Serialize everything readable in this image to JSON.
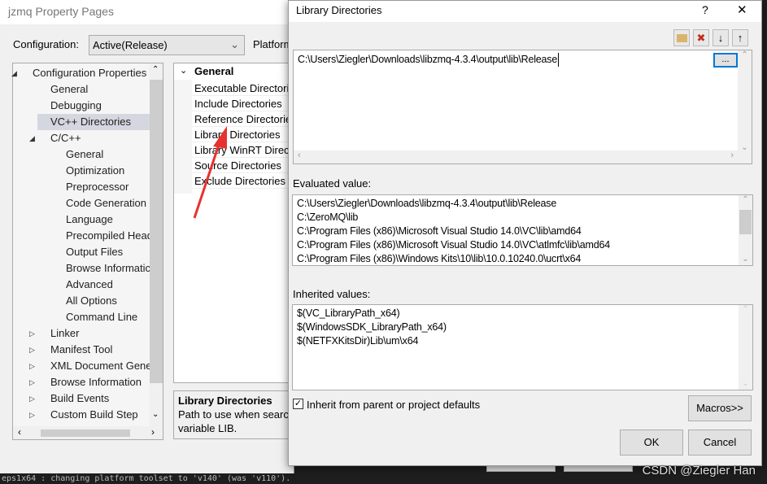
{
  "main": {
    "title": "jzmq Property Pages",
    "configuration_label": "Configuration:",
    "configuration_value": "Active(Release)",
    "platform_label": "Platform",
    "tree": [
      {
        "label": "Configuration Properties",
        "level": 0,
        "expanded": true
      },
      {
        "label": "General",
        "level": 1
      },
      {
        "label": "Debugging",
        "level": 1
      },
      {
        "label": "VC++ Directories",
        "level": 1,
        "selected": true
      },
      {
        "label": "C/C++",
        "level": 1,
        "expanded": true
      },
      {
        "label": "General",
        "level": 2
      },
      {
        "label": "Optimization",
        "level": 2
      },
      {
        "label": "Preprocessor",
        "level": 2
      },
      {
        "label": "Code Generation",
        "level": 2
      },
      {
        "label": "Language",
        "level": 2
      },
      {
        "label": "Precompiled Head",
        "level": 2
      },
      {
        "label": "Output Files",
        "level": 2
      },
      {
        "label": "Browse Informatic",
        "level": 2
      },
      {
        "label": "Advanced",
        "level": 2
      },
      {
        "label": "All Options",
        "level": 2
      },
      {
        "label": "Command Line",
        "level": 2
      },
      {
        "label": "Linker",
        "level": 1,
        "collapsed": true
      },
      {
        "label": "Manifest Tool",
        "level": 1,
        "collapsed": true
      },
      {
        "label": "XML Document Gene",
        "level": 1,
        "collapsed": true
      },
      {
        "label": "Browse Information",
        "level": 1,
        "collapsed": true
      },
      {
        "label": "Build Events",
        "level": 1,
        "collapsed": true
      },
      {
        "label": "Custom Build Step",
        "level": 1,
        "collapsed": true
      }
    ],
    "grid": {
      "section": "General",
      "rows": [
        "Executable Directori",
        "Include Directories",
        "Reference Directorie",
        "Library Directories",
        "Library WinRT Direc",
        "Source Directories",
        "Exclude Directories"
      ]
    },
    "description": {
      "title": "Library Directories",
      "line1": "Path to use when searc",
      "line2": "variable LIB."
    }
  },
  "dialog": {
    "title": "Library Directories",
    "help": "?",
    "close": "✕",
    "toolbar": {
      "new_line": "new-folder-icon",
      "delete": "✖",
      "down": "🡓",
      "up": "🡑"
    },
    "edit_value": "C:\\Users\\Ziegler\\Downloads\\libzmq-4.3.4\\output\\lib\\Release",
    "browse_label": "...",
    "evaluated_label": "Evaluated value:",
    "evaluated": [
      "C:\\Users\\Ziegler\\Downloads\\libzmq-4.3.4\\output\\lib\\Release",
      "C:\\ZeroMQ\\lib",
      "C:\\Program Files (x86)\\Microsoft Visual Studio 14.0\\VC\\lib\\amd64",
      "C:\\Program Files (x86)\\Microsoft Visual Studio 14.0\\VC\\atlmfc\\lib\\amd64",
      "C:\\Program Files (x86)\\Windows Kits\\10\\lib\\10.0.10240.0\\ucrt\\x64"
    ],
    "inherited_label": "Inherited values:",
    "inherited": [
      "$(VC_LibraryPath_x64)",
      "$(WindowsSDK_LibraryPath_x64)",
      "$(NETFXKitsDir)Lib\\um\\x64"
    ],
    "inherit_checkbox": "Inherit from parent or project defaults",
    "inherit_checked": true,
    "macros": "Macros>>",
    "ok": "OK",
    "cancel": "Cancel"
  },
  "background_console": "eps1x64 : changing platform toolset to 'v140' (was 'v110').",
  "watermark": "CSDN @Ziegler Han",
  "colors": {
    "selection": "#d5d7e0",
    "focus": "#0078d7",
    "arrow": "#e8312f"
  }
}
